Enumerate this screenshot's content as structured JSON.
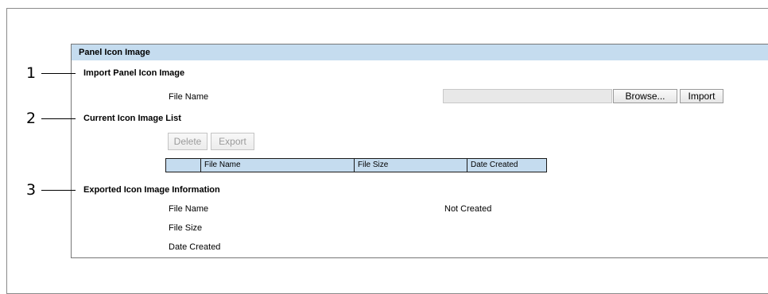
{
  "panel": {
    "title": "Panel Icon Image"
  },
  "callouts": [
    "1",
    "2",
    "3"
  ],
  "import_section": {
    "title": "Import Panel Icon Image",
    "file_name_label": "File Name",
    "file_name_value": "",
    "browse_label": "Browse...",
    "import_label": "Import"
  },
  "current_list": {
    "title": "Current Icon Image List",
    "delete_label": "Delete",
    "export_label": "Export",
    "columns": [
      "",
      "File Name",
      "File Size",
      "Date Created"
    ]
  },
  "exported_info": {
    "title": "Exported Icon Image Information",
    "file_name_label": "File Name",
    "file_name_value": "Not Created",
    "file_size_label": "File Size",
    "file_size_value": "",
    "date_created_label": "Date Created",
    "date_created_value": ""
  }
}
